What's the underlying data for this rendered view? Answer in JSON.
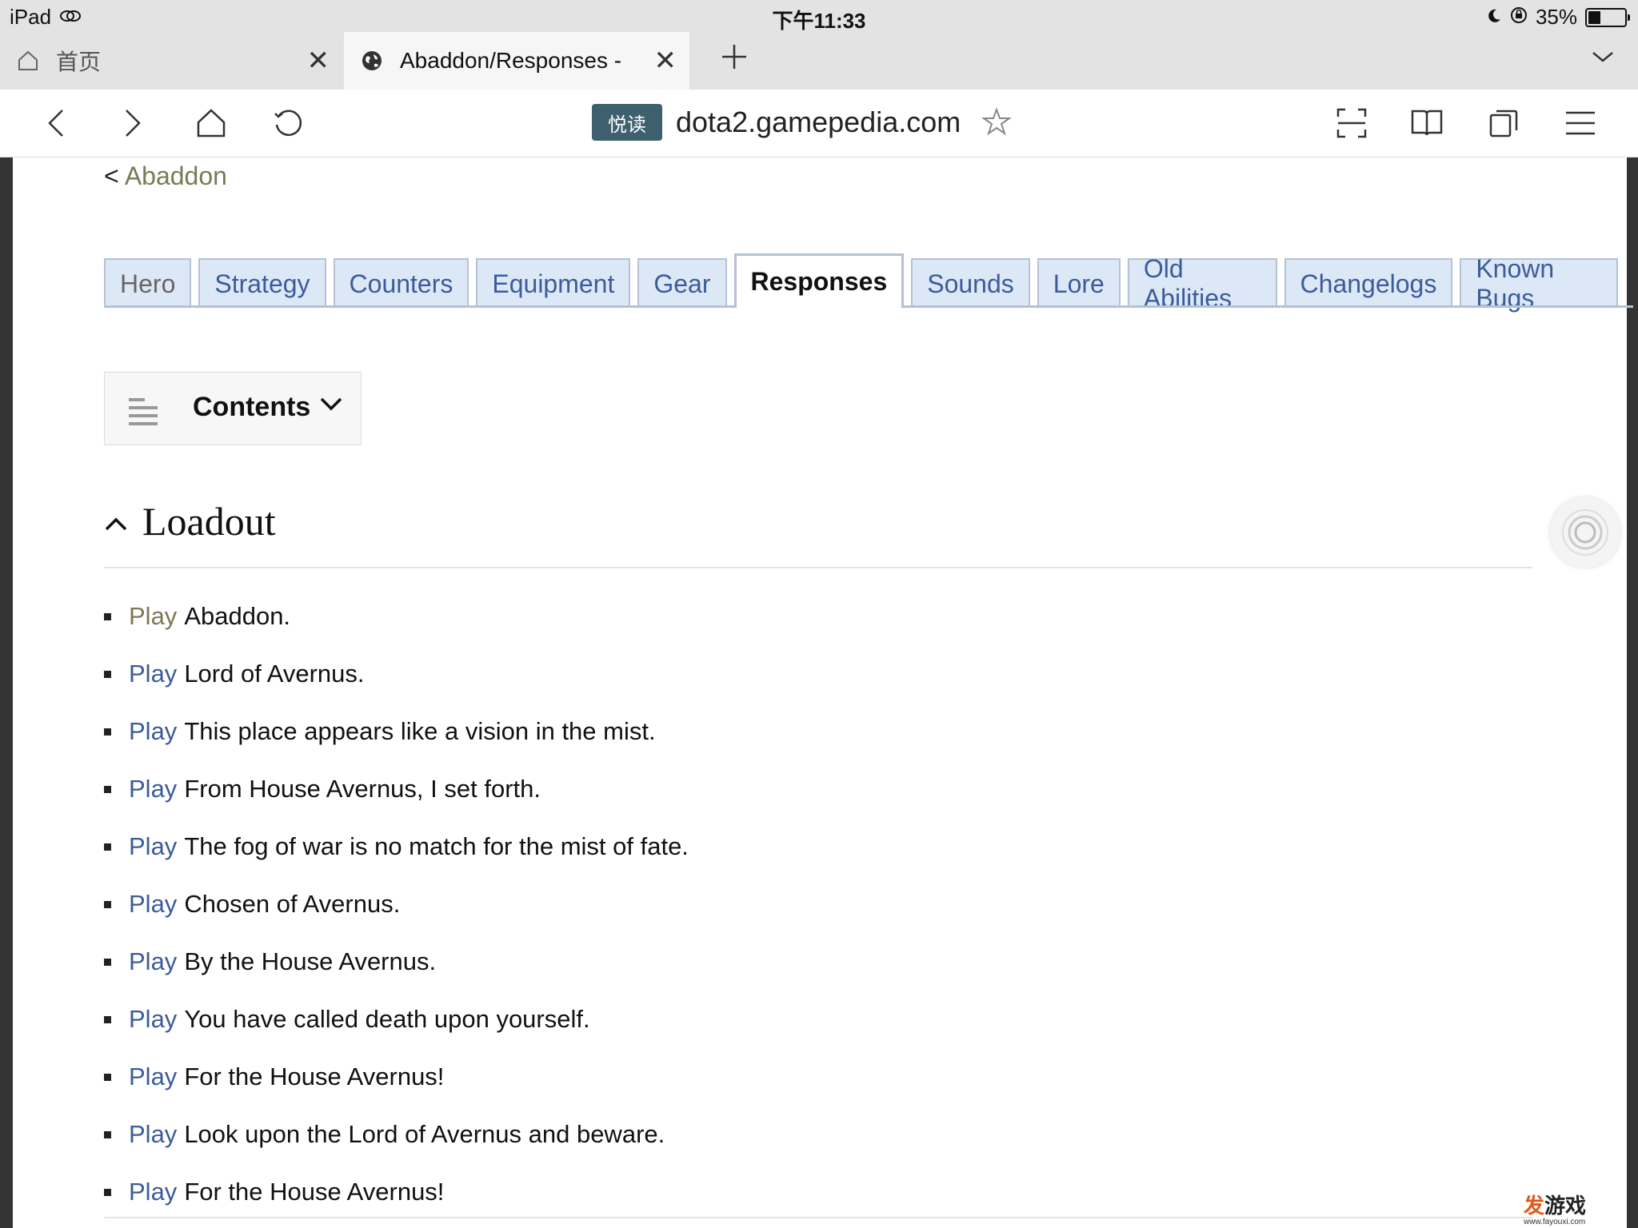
{
  "status_bar": {
    "device": "iPad",
    "time": "下午11:33",
    "battery": "35%",
    "battery_level": 0.35
  },
  "browser": {
    "tabs": [
      {
        "title": "首页",
        "active": false,
        "icon": "home-icon"
      },
      {
        "title": "Abaddon/Responses - ",
        "active": true,
        "icon": "globe-icon"
      }
    ],
    "reader_badge": "悦读",
    "url": "dota2.gamepedia.com"
  },
  "page": {
    "breadcrumb_prefix": "< ",
    "breadcrumb_link": "Abaddon",
    "nav_tabs": [
      {
        "label": "Hero"
      },
      {
        "label": "Strategy"
      },
      {
        "label": "Counters"
      },
      {
        "label": "Equipment"
      },
      {
        "label": "Gear"
      },
      {
        "label": "Responses",
        "active": true
      },
      {
        "label": "Sounds"
      },
      {
        "label": "Lore"
      },
      {
        "label": "Old Abilities"
      },
      {
        "label": "Changelogs"
      },
      {
        "label": "Known Bugs"
      }
    ],
    "toc_label": "Contents",
    "section_title": "Loadout",
    "play_label": "Play",
    "responses": [
      {
        "text": "Abaddon.",
        "visited": true
      },
      {
        "text": "Lord of Avernus."
      },
      {
        "text": "This place appears like a vision in the mist."
      },
      {
        "text": "From House Avernus, I set forth."
      },
      {
        "text": "The fog of war is no match for the mist of fate."
      },
      {
        "text": "Chosen of Avernus."
      },
      {
        "text": "By the House Avernus."
      },
      {
        "text": "You have called death upon yourself."
      },
      {
        "text": "For the House Avernus!"
      },
      {
        "text": "Look upon the Lord of Avernus and beware."
      },
      {
        "text": "For the House Avernus!"
      }
    ]
  },
  "watermark": {
    "main_accent": "发",
    "main": "游戏",
    "sub": "www.fayouxi.com"
  },
  "colors": {
    "link": "#3b5c9b",
    "visited_link": "#7a7a55",
    "tab_bg": "#dde8f7",
    "tab_border": "#b5c2d4",
    "reader_badge": "#3d5f6e"
  }
}
